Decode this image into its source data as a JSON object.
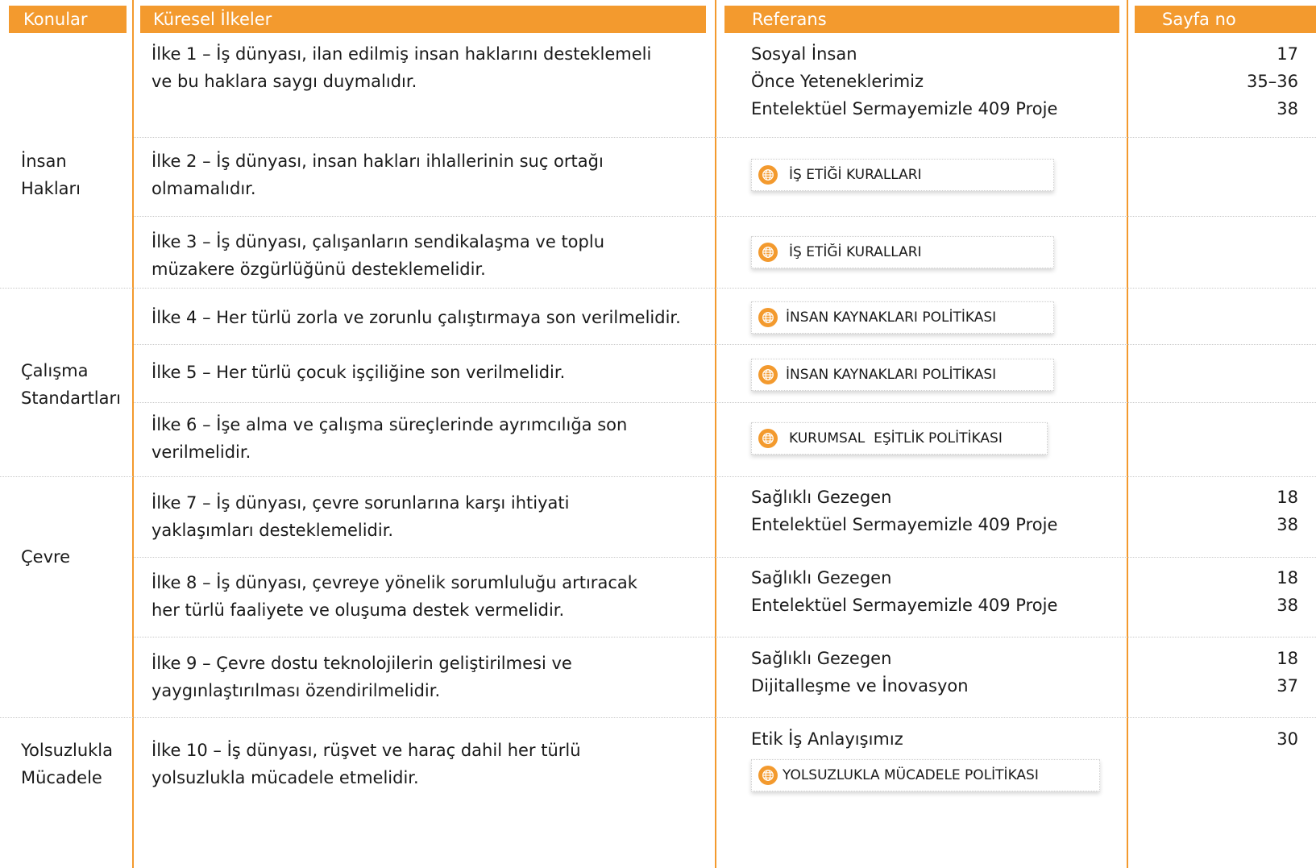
{
  "colors": {
    "accent": "#f39a2e",
    "text": "#1a1a1a",
    "separator": "#c9c9c9"
  },
  "headers": {
    "topics": "Konular",
    "principles": "Küresel İlkeler",
    "reference": "Referans",
    "page_no": "Sayfa no"
  },
  "topics": {
    "human_rights": [
      "İnsan",
      "Hakları"
    ],
    "labour": [
      "Çalışma",
      "Standartları"
    ],
    "environment": [
      "Çevre"
    ],
    "anticorruption": [
      "Yolsuzlukla",
      "Mücadele"
    ]
  },
  "principles": [
    [
      "İlke 1 – İş dünyası, ilan edilmiş insan haklarını desteklemeli",
      "ve bu haklara saygı duymalıdır."
    ],
    [
      "İlke 2 – İş dünyası, insan hakları ihlallerinin suç ortağı",
      "olmamalıdır."
    ],
    [
      "İlke 3 – İş dünyası, çalışanların sendikalaşma ve toplu",
      "müzakere özgürlüğünü desteklemelidir."
    ],
    [
      "İlke 4 – Her türlü zorla ve zorunlu çalıştırmaya son verilmelidir."
    ],
    [
      "İlke 5 – Her türlü çocuk işçiliğine son verilmelidir."
    ],
    [
      "İlke 6 – İşe alma ve çalışma süreçlerinde ayrımcılığa son",
      "verilmelidir."
    ],
    [
      "İlke 7 – İş dünyası, çevre sorunlarına karşı ihtiyati",
      "yaklaşımları desteklemelidir."
    ],
    [
      "İlke 8 – İş dünyası, çevreye yönelik sorumluluğu artıracak",
      "her türlü faaliyete ve oluşuma destek vermelidir."
    ],
    [
      "İlke 9 – Çevre dostu teknolojilerin geliştirilmesi ve",
      "yaygınlaştırılması özendirilmelidir."
    ],
    [
      "İlke 10 – İş dünyası, rüşvet ve haraç dahil her türlü",
      "yolsuzlukla mücadele etmelidir."
    ]
  ],
  "references": {
    "p1": [
      {
        "text": "Sosyal İnsan",
        "page": "17"
      },
      {
        "text": "Önce Yeteneklerimiz",
        "page": "35–36"
      },
      {
        "text": "Entelektüel Sermayemizle 409 Proje",
        "page": "38"
      }
    ],
    "p2_link": "İŞ ETİĞİ KURALLARI",
    "p3_link": "İŞ ETİĞİ KURALLARI",
    "p4_link": "İNSAN KAYNAKLARI POLİTİKASI",
    "p5_link": "İNSAN KAYNAKLARI POLİTİKASI",
    "p6_link": "KURUMSAL  EŞİTLİK POLİTİKASI",
    "p7": [
      {
        "text": "Sağlıklı Gezegen",
        "page": "18"
      },
      {
        "text": "Entelektüel Sermayemizle 409 Proje",
        "page": "38"
      }
    ],
    "p8": [
      {
        "text": "Sağlıklı Gezegen",
        "page": "18"
      },
      {
        "text": "Entelektüel Sermayemizle 409 Proje",
        "page": "38"
      }
    ],
    "p9": [
      {
        "text": "Sağlıklı Gezegen",
        "page": "18"
      },
      {
        "text": "Dijitalleşme ve İnovasyon",
        "page": "37"
      }
    ],
    "p10": [
      {
        "text": "Etik İş Anlayışımız",
        "page": "30"
      }
    ],
    "p10_link": "YOLSUZLUKLA MÜCADELE POLİTİKASI"
  },
  "icons": {
    "link_icon": "globe-icon"
  }
}
